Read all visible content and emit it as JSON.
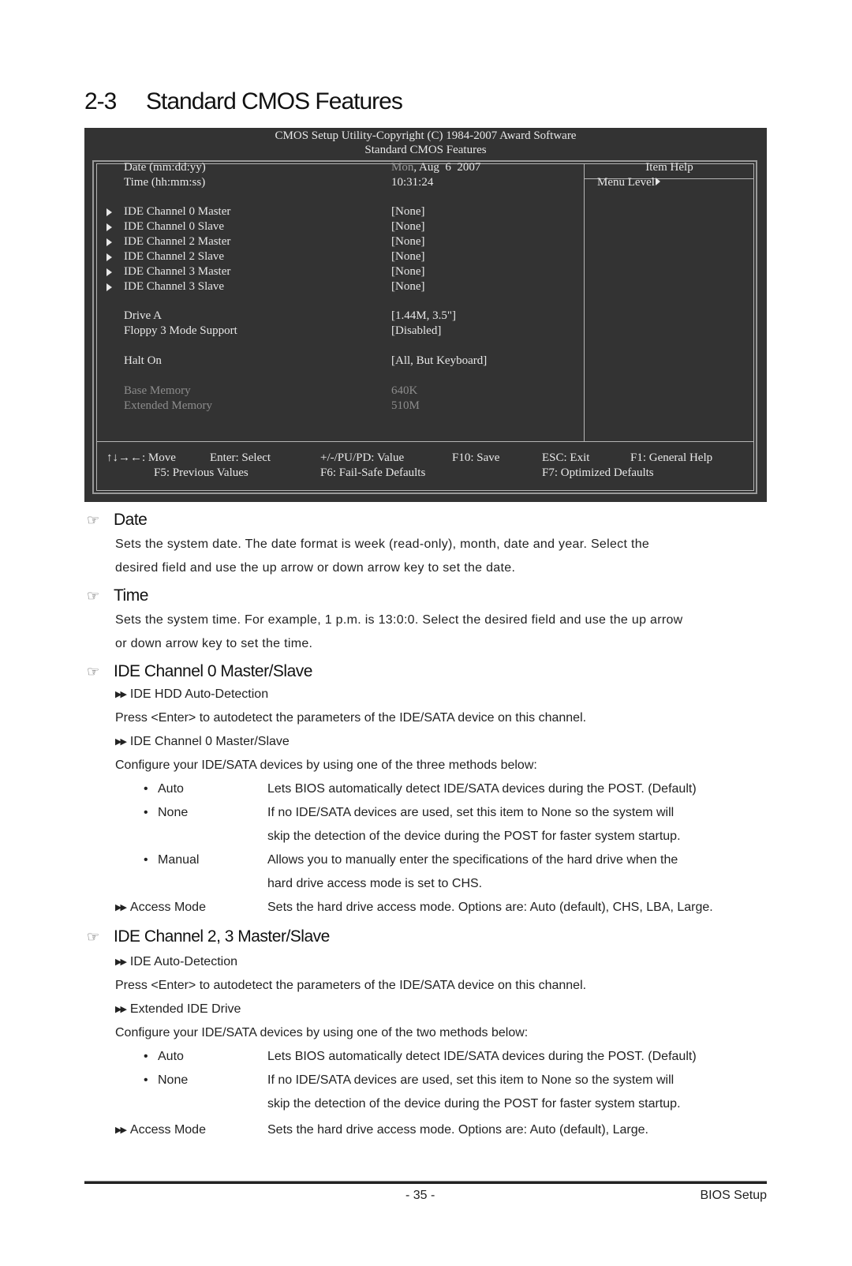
{
  "heading": {
    "number": "2-3",
    "title": "Standard CMOS Features"
  },
  "bios": {
    "caption_line1": "CMOS Setup Utility-Copyright (C) 1984-2007 Award Software",
    "caption_line2": "Standard CMOS Features",
    "help_title": "Item Help",
    "help_menu_level": "Menu Level",
    "date": {
      "label": "Date (mm:dd:yy)",
      "weekday": "Mon",
      "value": ", Aug  6  2007"
    },
    "time": {
      "label": "Time (hh:mm:ss)",
      "value": "10:31:24"
    },
    "ide_items": [
      {
        "label": "IDE Channel 0 Master",
        "value": "[None]"
      },
      {
        "label": "IDE Channel 0 Slave",
        "value": "[None]"
      },
      {
        "label": "IDE Channel 2 Master",
        "value": "[None]"
      },
      {
        "label": "IDE Channel 2 Slave",
        "value": "[None]"
      },
      {
        "label": "IDE Channel 3 Master",
        "value": "[None]"
      },
      {
        "label": "IDE Channel 3 Slave",
        "value": "[None]"
      }
    ],
    "drive_a": {
      "label": "Drive A",
      "value": "[1.44M, 3.5\"]"
    },
    "floppy3": {
      "label": "Floppy 3 Mode Support",
      "value": "[Disabled]"
    },
    "halt_on": {
      "label": "Halt On",
      "value": "[All, But Keyboard]"
    },
    "base_memory": {
      "label": "Base Memory",
      "value": "640K"
    },
    "extended_memory": {
      "label": "Extended Memory",
      "value": "510M"
    },
    "keys": {
      "move": "↑↓→←: Move",
      "enter": "Enter: Select",
      "value": "+/-/PU/PD: Value",
      "save": "F10: Save",
      "esc": "ESC: Exit",
      "help": "F1: General Help",
      "f5": "F5: Previous Values",
      "f6": "F6: Fail-Safe Defaults",
      "f7": "F7: Optimized Defaults"
    }
  },
  "sections": {
    "date": {
      "title": "Date",
      "text_line1": "Sets the system date. The date format is week (read-only), month, date and  year.  Select  the",
      "text_line2": "desired field and use the up arrow or down arrow key to set the date."
    },
    "time": {
      "title": "Time",
      "text_line1": "Sets the system time. For example, 1 p.m. is 13:0:0. Select the desired field and use the up arrow",
      "text_line2": "or down arrow key to set the time."
    },
    "ide0": {
      "title": "IDE Channel 0 Master/Slave",
      "sub1": "IDE HDD Auto-Detection",
      "sub1_text": "Press <Enter> to autodetect the parameters of the IDE/SATA device on this channel.",
      "sub2": "IDE Channel 0 Master/Slave",
      "sub2_text": "Configure your IDE/SATA devices by using one of the three methods below:",
      "options": [
        {
          "name": "Auto",
          "lines": [
            "Lets BIOS automatically detect IDE/SATA devices during the POST. (Default)"
          ]
        },
        {
          "name": "None",
          "lines": [
            "If no IDE/SATA devices are used, set this item to None so the system will",
            "skip the detection of the device during the POST for faster system startup."
          ]
        },
        {
          "name": "Manual",
          "lines": [
            "Allows you to manually enter the specifications of the hard drive when the",
            "hard drive access mode is set to CHS."
          ]
        }
      ],
      "access_mode_label": "Access Mode",
      "access_mode_text": "Sets the hard drive access mode. Options are: Auto (default), CHS, LBA, Large."
    },
    "ide23": {
      "title": "IDE Channel 2, 3 Master/Slave",
      "sub1": "IDE Auto-Detection",
      "sub1_text": "Press <Enter> to autodetect the parameters of the IDE/SATA device on this channel.",
      "sub2": "Extended IDE Drive",
      "sub2_text": "Configure your IDE/SATA devices by using one of the two methods below:",
      "options": [
        {
          "name": "Auto",
          "lines": [
            "Lets BIOS automatically detect IDE/SATA devices during the POST. (Default)"
          ]
        },
        {
          "name": "None",
          "lines": [
            "If no IDE/SATA devices are used, set this item to None so the system will",
            "skip the detection of the device during the POST for faster system startup."
          ]
        }
      ],
      "access_mode_label": "Access Mode",
      "access_mode_text": "Sets the hard drive access mode. Options are: Auto (default), Large."
    }
  },
  "footer": {
    "page": "- 35 -",
    "section": "BIOS Setup"
  },
  "icons": {
    "section_marker": "pointing-hand-icon",
    "sub_marker": "double-triangle-icon",
    "bullet": "bullet-icon"
  }
}
